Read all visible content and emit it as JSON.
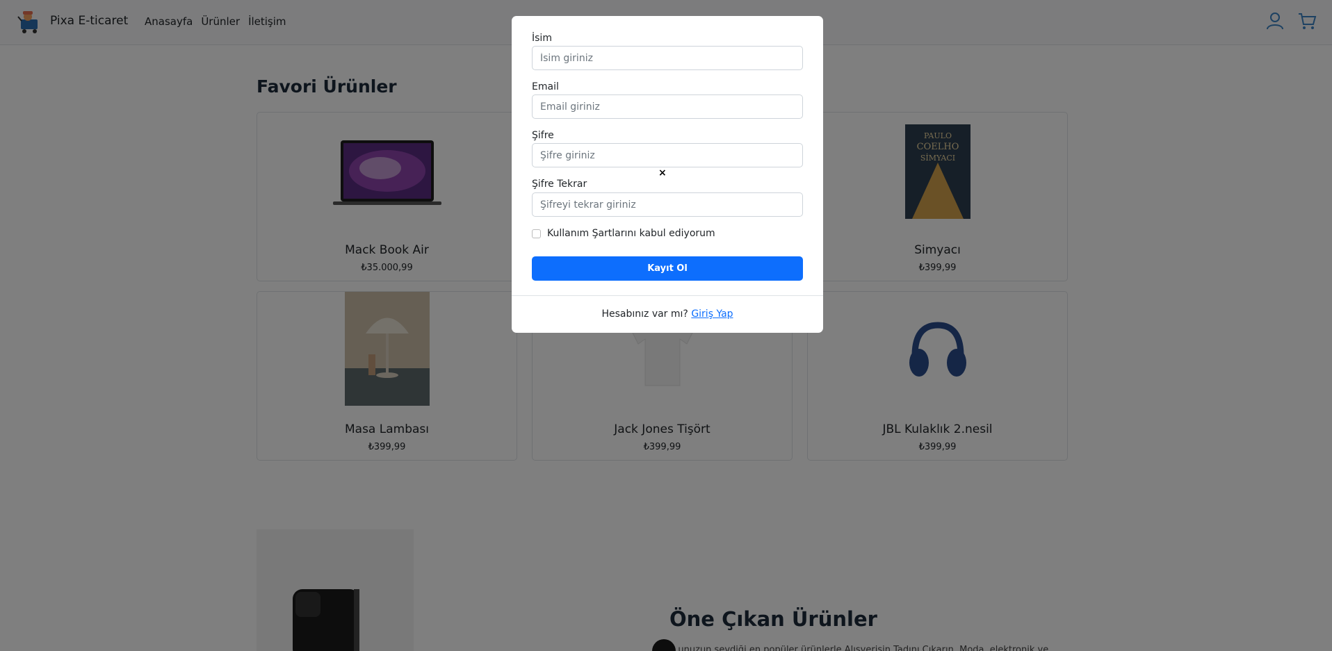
{
  "navbar": {
    "brand": "Pixa E-ticaret",
    "links": [
      "Anasayfa",
      "Ürünler",
      "İletişim"
    ]
  },
  "favorites": {
    "title": "Favori Ürünler",
    "products": [
      {
        "name": "Mack Book Air",
        "price": "₺35.000,99",
        "image": "laptop"
      },
      {
        "name": "",
        "price": "",
        "image": "hidden"
      },
      {
        "name": "Simyacı",
        "price": "₺399,99",
        "image": "book",
        "book_text": [
          "PAULO",
          "COELHO",
          "SİMYACI"
        ]
      },
      {
        "name": "Masa Lambası",
        "price": "₺399,99",
        "image": "lamp"
      },
      {
        "name": "Jack Jones Tişört",
        "price": "₺399,99",
        "image": "tshirt"
      },
      {
        "name": "JBL Kulaklık 2.nesil",
        "price": "₺399,99",
        "image": "headphones"
      }
    ]
  },
  "featured": {
    "title": "Öne Çıkan Ürünler",
    "text": "...unuzun sevdiği en popüler ürünlerle Alışverişin Tadını Çıkarın. Moda, elektronik ve"
  },
  "register_modal": {
    "fields": [
      {
        "label": "İsim",
        "placeholder": "İsim giriniz",
        "type": "text"
      },
      {
        "label": "Email",
        "placeholder": "Email giriniz",
        "type": "email"
      },
      {
        "label": "Şifre",
        "placeholder": "Şifre giriniz",
        "type": "password"
      },
      {
        "label": "Şifre Tekrar",
        "placeholder": "Şifreyi tekrar giriniz",
        "type": "password"
      }
    ],
    "close_label": "×",
    "terms_label": "Kullanım Şartlarını kabul ediyorum",
    "submit_label": "Kayıt Ol",
    "footer_text": "Hesabınız var mı?",
    "login_link": "Giriş Yap"
  },
  "colors": {
    "primary": "#0d6efd",
    "overlay": "rgba(0,0,0,0.5)",
    "navbar_bg": "#f8f9fa"
  },
  "icons": [
    "cart-logo-icon",
    "user-icon",
    "cart-icon",
    "close-icon"
  ]
}
